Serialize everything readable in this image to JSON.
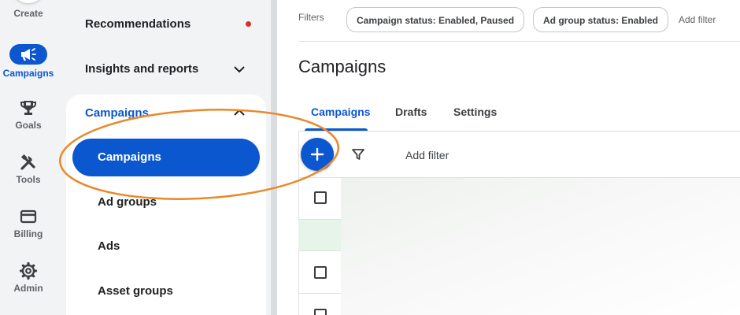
{
  "rail": {
    "create_label": "Create",
    "items": [
      {
        "label": "Campaigns",
        "icon": "megaphone-icon",
        "active": true
      },
      {
        "label": "Goals",
        "icon": "trophy-icon"
      },
      {
        "label": "Tools",
        "icon": "tools-icon"
      },
      {
        "label": "Billing",
        "icon": "credit-card-icon"
      },
      {
        "label": "Admin",
        "icon": "gear-icon"
      }
    ]
  },
  "nav": {
    "recommendations": "Recommendations",
    "insights": "Insights and reports",
    "group_title": "Campaigns",
    "items": [
      "Campaigns",
      "Ad groups",
      "Ads",
      "Asset groups"
    ]
  },
  "main": {
    "filters_label": "Filters",
    "chips": [
      "Campaign status: Enabled, Paused",
      "Ad group status: Enabled"
    ],
    "add_filter_top": "Add filter",
    "title": "Campaigns",
    "tabs": [
      "Campaigns",
      "Drafts",
      "Settings"
    ],
    "active_tab": 0,
    "add_filter": "Add filter"
  },
  "colors": {
    "accent": "#0b57d0",
    "notification_dot": "#d93025",
    "annotation": "#e8892a"
  }
}
